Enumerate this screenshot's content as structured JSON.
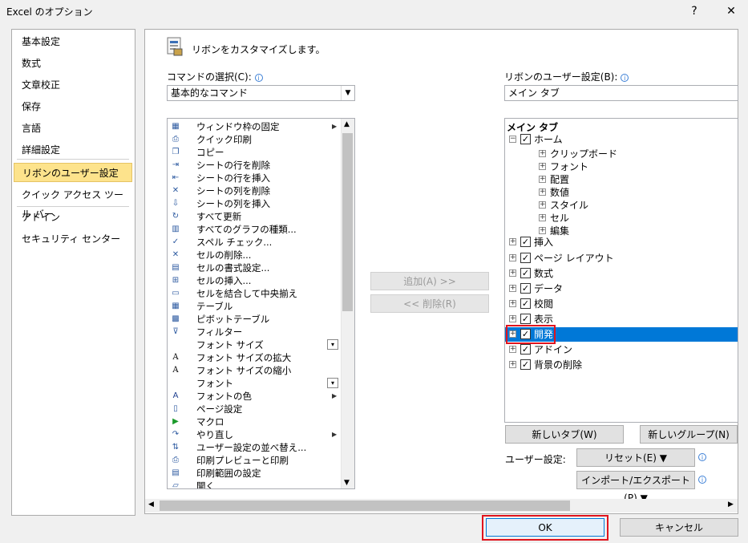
{
  "window": {
    "title": "Excel のオプション",
    "help_label": "?",
    "close_label": "✕"
  },
  "nav": {
    "items": [
      {
        "label": "基本設定"
      },
      {
        "label": "数式"
      },
      {
        "label": "文章校正"
      },
      {
        "label": "保存"
      },
      {
        "label": "言語"
      },
      {
        "label": "詳細設定"
      },
      {
        "label": "リボンのユーザー設定"
      },
      {
        "label": "クイック アクセス ツール バー"
      },
      {
        "label": "アドイン"
      },
      {
        "label": "セキュリティ センター"
      }
    ],
    "selected": "リボンのユーザー設定"
  },
  "header": {
    "text": "リボンをカスタマイズします。"
  },
  "commands": {
    "label": "コマンドの選択(C):",
    "dropdown_value": "基本的なコマンド",
    "items": [
      {
        "label": "ウィンドウ枠の固定",
        "icon": "freeze-panes-icon",
        "submenu": true
      },
      {
        "label": "クイック印刷",
        "icon": "quick-print-icon"
      },
      {
        "label": "コピー",
        "icon": "copy-icon"
      },
      {
        "label": "シートの行を削除",
        "icon": "delete-row-icon"
      },
      {
        "label": "シートの行を挿入",
        "icon": "insert-row-icon"
      },
      {
        "label": "シートの列を削除",
        "icon": "delete-column-icon"
      },
      {
        "label": "シートの列を挿入",
        "icon": "insert-column-icon"
      },
      {
        "label": "すべて更新",
        "icon": "refresh-all-icon"
      },
      {
        "label": "すべてのグラフの種類...",
        "icon": "chart-types-icon"
      },
      {
        "label": "スペル チェック...",
        "icon": "spell-check-icon"
      },
      {
        "label": "セルの削除...",
        "icon": "delete-cells-icon"
      },
      {
        "label": "セルの書式設定...",
        "icon": "format-cells-icon"
      },
      {
        "label": "セルの挿入...",
        "icon": "insert-cells-icon"
      },
      {
        "label": "セルを結合して中央揃え",
        "icon": "merge-center-icon"
      },
      {
        "label": "テーブル",
        "icon": "table-icon"
      },
      {
        "label": "ピボットテーブル",
        "icon": "pivot-table-icon"
      },
      {
        "label": "フィルター",
        "icon": "filter-icon"
      },
      {
        "label": "フォント サイズ",
        "icon": "font-size-icon",
        "combo": true
      },
      {
        "label": "フォント サイズの拡大",
        "icon": "grow-font-icon"
      },
      {
        "label": "フォント サイズの縮小",
        "icon": "shrink-font-icon"
      },
      {
        "label": "フォント",
        "icon": "font-icon",
        "combo": true
      },
      {
        "label": "フォントの色",
        "icon": "font-color-icon",
        "submenu": true
      },
      {
        "label": "ページ設定",
        "icon": "page-setup-icon"
      },
      {
        "label": "マクロ",
        "icon": "macro-icon"
      },
      {
        "label": "やり直し",
        "icon": "redo-icon",
        "submenu": true
      },
      {
        "label": "ユーザー設定の並べ替え...",
        "icon": "custom-sort-icon"
      },
      {
        "label": "印刷プレビューと印刷",
        "icon": "print-preview-icon"
      },
      {
        "label": "印刷範囲の設定",
        "icon": "print-area-icon"
      },
      {
        "label": "開く",
        "icon": "open-icon"
      }
    ]
  },
  "middle": {
    "add_label": "追加(A) >>",
    "remove_label": "<< 削除(R)"
  },
  "ribbon": {
    "label": "リボンのユーザー設定(B):",
    "dropdown_value": "メイン タブ",
    "tree_header": "メイン タブ",
    "tree": [
      {
        "label": "ホーム",
        "level": 0,
        "expanded": true,
        "checked": true
      },
      {
        "label": "クリップボード",
        "level": 1
      },
      {
        "label": "フォント",
        "level": 1
      },
      {
        "label": "配置",
        "level": 1
      },
      {
        "label": "数値",
        "level": 1
      },
      {
        "label": "スタイル",
        "level": 1
      },
      {
        "label": "セル",
        "level": 1
      },
      {
        "label": "編集",
        "level": 1
      },
      {
        "label": "挿入",
        "level": 0,
        "checked": true
      },
      {
        "label": "ページ レイアウト",
        "level": 0,
        "checked": true
      },
      {
        "label": "数式",
        "level": 0,
        "checked": true
      },
      {
        "label": "データ",
        "level": 0,
        "checked": true
      },
      {
        "label": "校閲",
        "level": 0,
        "checked": true
      },
      {
        "label": "表示",
        "level": 0,
        "checked": true
      },
      {
        "label": "開発",
        "level": 0,
        "checked": true,
        "selected": true
      },
      {
        "label": "アドイン",
        "level": 0,
        "checked": true
      },
      {
        "label": "背景の削除",
        "level": 0,
        "checked": true
      }
    ],
    "new_tab_label": "新しいタブ(W)",
    "new_group_label": "新しいグループ(N)",
    "user_settings_label": "ユーザー設定:",
    "reset_label": "リセット(E) ▼",
    "import_export_label": "インポート/エクスポート(P) ▼"
  },
  "footer": {
    "ok_label": "OK",
    "cancel_label": "キャンセル"
  },
  "colors": {
    "selection": "#0078d7",
    "nav_selected": "#fde38c",
    "highlight_box": "#e0141e"
  }
}
